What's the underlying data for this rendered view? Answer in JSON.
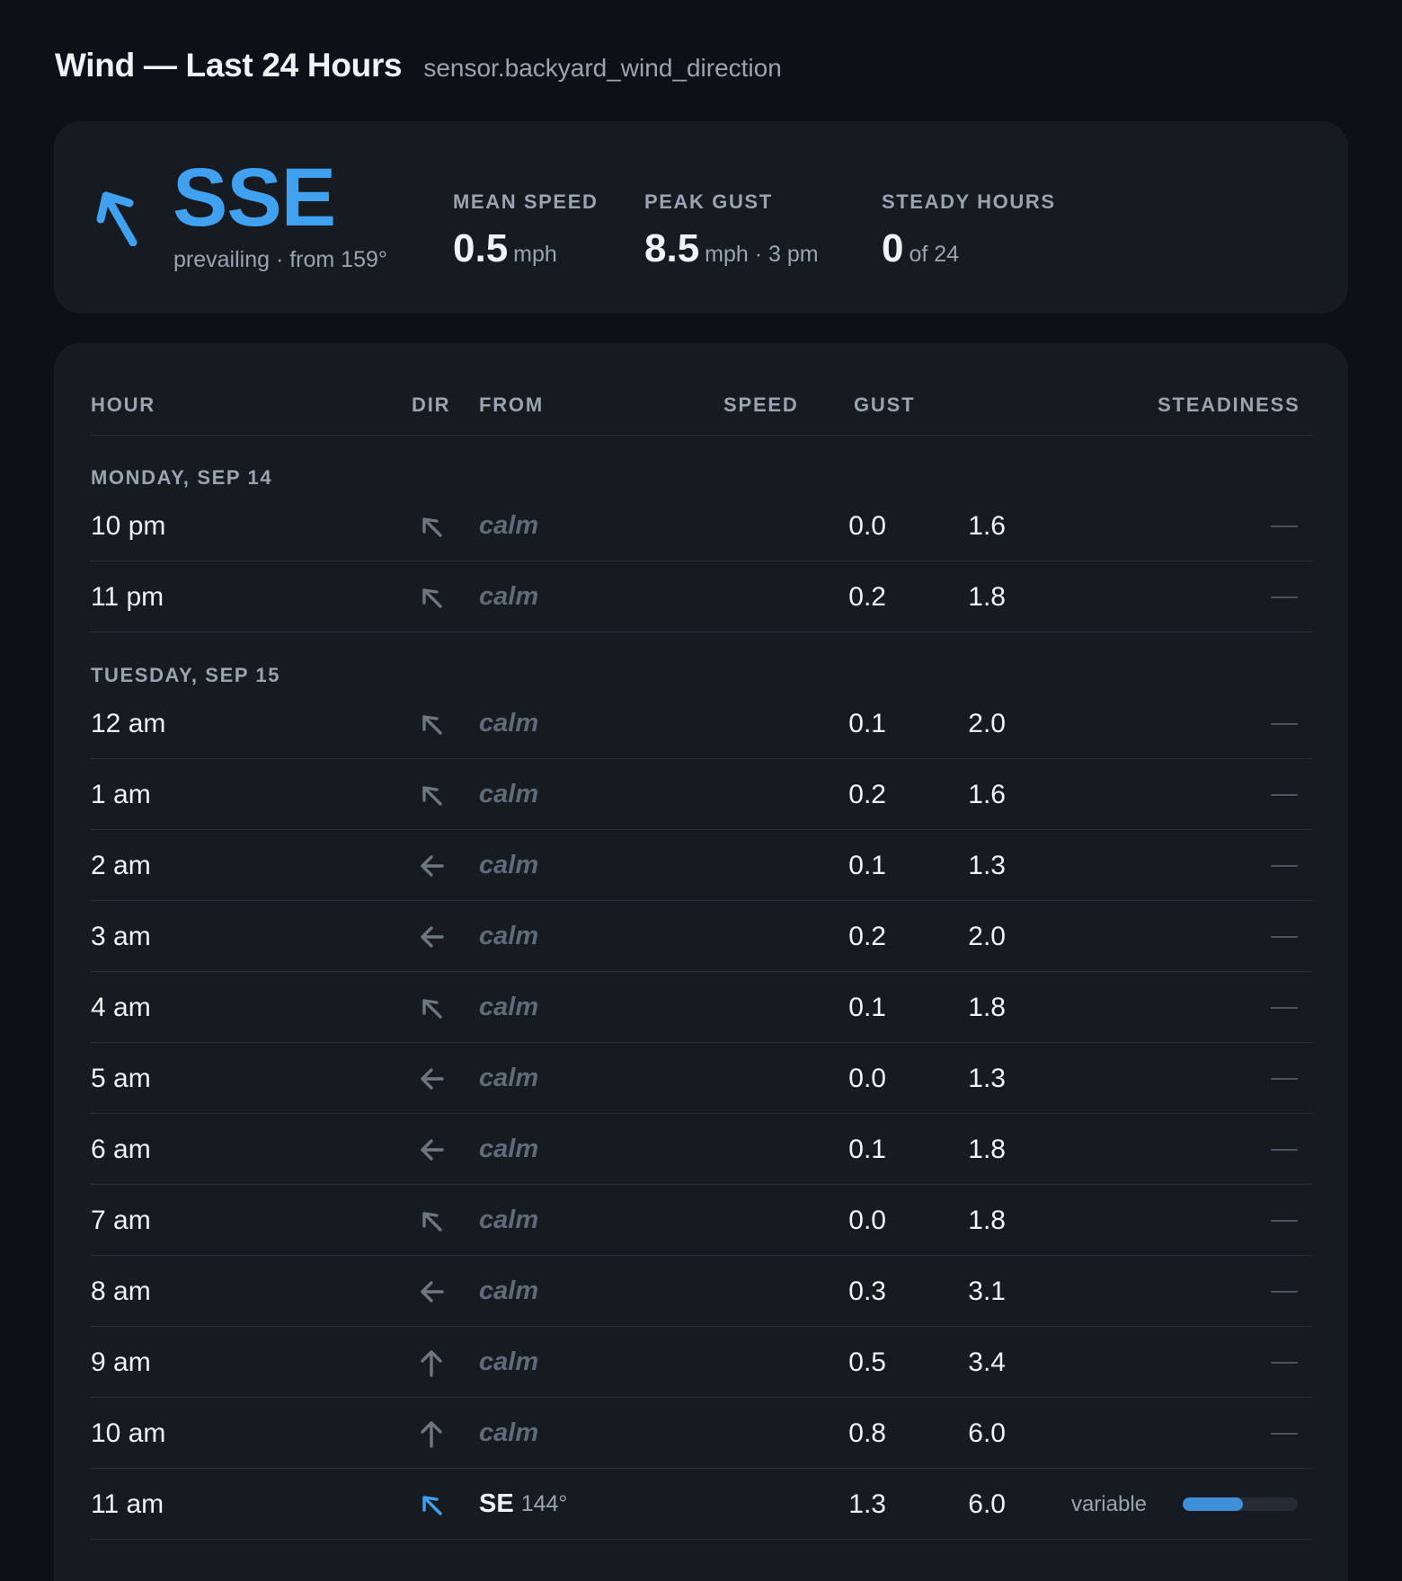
{
  "header": {
    "title": "Wind — Last 24 Hours",
    "entity": "sensor.backyard_wind_direction"
  },
  "summary": {
    "prevailing_direction": "SSE",
    "prevailing_sub": "prevailing · from 159°",
    "prevailing_icon": "arrow-up-left-icon",
    "accent_color": "#3fa1f0",
    "stats": [
      {
        "label": "MEAN SPEED",
        "value": "0.5",
        "suffix": "mph"
      },
      {
        "label": "PEAK GUST",
        "value": "8.5",
        "suffix": "mph · 3 pm"
      },
      {
        "label": "STEADY HOURS",
        "value": "0",
        "suffix": "of 24"
      }
    ]
  },
  "table": {
    "columns": {
      "hour": "HOUR",
      "dir": "DIR",
      "from": "FROM",
      "speed": "SPEED",
      "gust": "GUST",
      "steadiness": "STEADINESS"
    },
    "groups": [
      {
        "date": "MONDAY, SEP 14",
        "rows": [
          {
            "hour": "10 pm",
            "dir_icon": "arrow-up-left-icon",
            "from": "calm",
            "speed": "0.0",
            "gust": "1.6",
            "steadiness": "—"
          },
          {
            "hour": "11 pm",
            "dir_icon": "arrow-up-left-icon",
            "from": "calm",
            "speed": "0.2",
            "gust": "1.8",
            "steadiness": "—"
          }
        ]
      },
      {
        "date": "TUESDAY, SEP 15",
        "rows": [
          {
            "hour": "12 am",
            "dir_icon": "arrow-up-left-icon",
            "from": "calm",
            "speed": "0.1",
            "gust": "2.0",
            "steadiness": "—"
          },
          {
            "hour": "1 am",
            "dir_icon": "arrow-up-left-icon",
            "from": "calm",
            "speed": "0.2",
            "gust": "1.6",
            "steadiness": "—"
          },
          {
            "hour": "2 am",
            "dir_icon": "arrow-left-icon",
            "from": "calm",
            "speed": "0.1",
            "gust": "1.3",
            "steadiness": "—"
          },
          {
            "hour": "3 am",
            "dir_icon": "arrow-left-icon",
            "from": "calm",
            "speed": "0.2",
            "gust": "2.0",
            "steadiness": "—"
          },
          {
            "hour": "4 am",
            "dir_icon": "arrow-up-left-icon",
            "from": "calm",
            "speed": "0.1",
            "gust": "1.8",
            "steadiness": "—"
          },
          {
            "hour": "5 am",
            "dir_icon": "arrow-left-icon",
            "from": "calm",
            "speed": "0.0",
            "gust": "1.3",
            "steadiness": "—"
          },
          {
            "hour": "6 am",
            "dir_icon": "arrow-left-icon",
            "from": "calm",
            "speed": "0.1",
            "gust": "1.8",
            "steadiness": "—"
          },
          {
            "hour": "7 am",
            "dir_icon": "arrow-up-left-icon",
            "from": "calm",
            "speed": "0.0",
            "gust": "1.8",
            "steadiness": "—"
          },
          {
            "hour": "8 am",
            "dir_icon": "arrow-left-icon",
            "from": "calm",
            "speed": "0.3",
            "gust": "3.1",
            "steadiness": "—"
          },
          {
            "hour": "9 am",
            "dir_icon": "arrow-up-icon",
            "from": "calm",
            "speed": "0.5",
            "gust": "3.4",
            "steadiness": "—"
          },
          {
            "hour": "10 am",
            "dir_icon": "arrow-up-icon",
            "from": "calm",
            "speed": "0.8",
            "gust": "6.0",
            "steadiness": "—"
          },
          {
            "hour": "11 am",
            "dir_icon": "arrow-up-left-icon",
            "from": "SE",
            "from_deg": "144°",
            "speed": "1.3",
            "gust": "6.0",
            "steadiness": "variable",
            "steadiness_fraction": 0.52
          }
        ]
      }
    ]
  }
}
